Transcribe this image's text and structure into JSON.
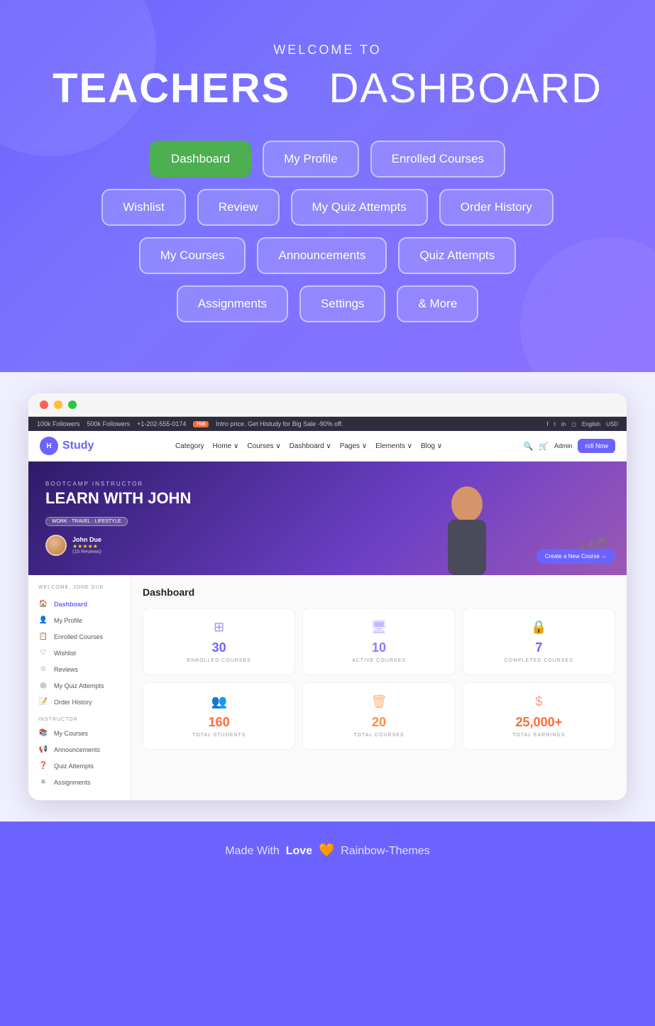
{
  "hero": {
    "welcome_text": "WELCOME TO",
    "title_bold": "TEACHERS",
    "title_light": "DASHBOARD"
  },
  "nav_buttons": {
    "row1": [
      {
        "label": "Dashboard",
        "active": true
      },
      {
        "label": "My Profile",
        "active": false
      },
      {
        "label": "Enrolled Courses",
        "active": false
      }
    ],
    "row2": [
      {
        "label": "Wishlist",
        "active": false
      },
      {
        "label": "Review",
        "active": false
      },
      {
        "label": "My Quiz Attempts",
        "active": false
      },
      {
        "label": "Order History",
        "active": false
      }
    ],
    "row3": [
      {
        "label": "My Courses",
        "active": false
      },
      {
        "label": "Announcements",
        "active": false
      },
      {
        "label": "Quiz Attempts",
        "active": false
      }
    ],
    "row4": [
      {
        "label": "Assignments",
        "active": false
      },
      {
        "label": "Settings",
        "active": false
      },
      {
        "label": "& More",
        "active": false
      }
    ]
  },
  "topbar": {
    "followers_1": "100k Followers",
    "followers_2": "500k Followers",
    "phone": "+1-202-555-0174",
    "badge": "Hot",
    "promo": "Intro price. Get Histudy for Big Sale -90% off.",
    "language": "English",
    "currency": "USD"
  },
  "sitenav": {
    "logo": "Study",
    "links": [
      "Category",
      "Home",
      "Courses",
      "Dashboard",
      "Pages",
      "Elements",
      "Blog"
    ],
    "admin": "Admin",
    "enroll": "roll Now"
  },
  "banner": {
    "subtitle": "BOOTCAMP INSTRUCTOR",
    "title": "LEARN WITH JOHN",
    "tag": "WORK · TRAVEL · LIFESTYLE",
    "instructor_name": "John Due",
    "instructor_reviews": "(15 Reviews)",
    "cta": "Create a New Course →"
  },
  "sidebar": {
    "welcome": "WELCOME, JONE DUE",
    "items": [
      {
        "icon": "🏠",
        "label": "Dashboard",
        "active": true
      },
      {
        "icon": "👤",
        "label": "My Profile",
        "active": false
      },
      {
        "icon": "📋",
        "label": "Enrolled Courses",
        "active": false
      },
      {
        "icon": "♡",
        "label": "Wishlist",
        "active": false
      },
      {
        "icon": "☆",
        "label": "Reviews",
        "active": false
      },
      {
        "icon": "◎",
        "label": "My Quiz Attempts",
        "active": false
      },
      {
        "icon": "📝",
        "label": "Order History",
        "active": false
      }
    ],
    "instructor_label": "INSTRUCTOR",
    "instructor_items": [
      {
        "icon": "📚",
        "label": "My Courses",
        "active": false
      },
      {
        "icon": "📢",
        "label": "Announcements",
        "active": false
      },
      {
        "icon": "❓",
        "label": "Quiz Attempts",
        "active": false
      },
      {
        "icon": "≡",
        "label": "Assignments",
        "active": false
      }
    ]
  },
  "dashboard": {
    "title": "Dashboard",
    "stats_row1": [
      {
        "icon": "⊞",
        "number": "30",
        "label": "ENROLLED COURSES",
        "color": "blue"
      },
      {
        "icon": "🖥",
        "number": "10",
        "label": "ACTIVE COURSES",
        "color": "purple"
      },
      {
        "icon": "🔒",
        "number": "7",
        "label": "COMPLETED COURSES",
        "color": "teal"
      }
    ],
    "stats_row2": [
      {
        "icon": "👥",
        "number": "160",
        "label": "TOTAL STUDENTS",
        "color": "orange"
      },
      {
        "icon": "🗑",
        "number": "20",
        "label": "TOTAL COURSES",
        "color": "amber"
      },
      {
        "icon": "$",
        "number": "25,000+",
        "label": "TOTAL EARNINGS",
        "color": "green"
      }
    ]
  },
  "footer": {
    "text": "Made With",
    "bold": "Love",
    "heart": "🧡",
    "brand": "Rainbow-Themes"
  }
}
